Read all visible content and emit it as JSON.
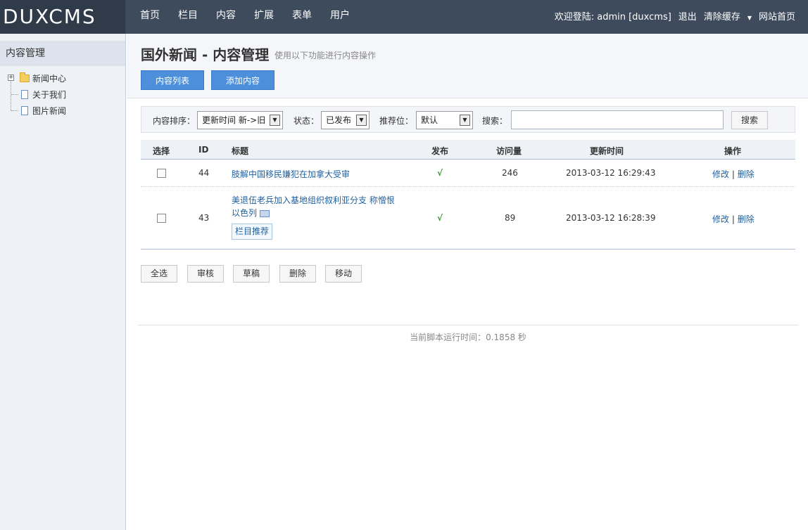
{
  "app": {
    "logo": "DUXCMS"
  },
  "nav": {
    "items": [
      "首页",
      "栏目",
      "内容",
      "扩展",
      "表单",
      "用户"
    ]
  },
  "userbar": {
    "welcome": "欢迎登陆: admin [duxcms]",
    "logout": "退出",
    "clear_cache": "清除缓存",
    "site_home": "网站首页"
  },
  "sidebar": {
    "title": "内容管理",
    "tree": [
      {
        "label": "新闻中心",
        "icon": "folder-icon"
      },
      {
        "label": "关于我们",
        "icon": "document-icon"
      },
      {
        "label": "图片新闻",
        "icon": "document-icon"
      }
    ]
  },
  "header": {
    "title": "国外新闻 - 内容管理",
    "subtitle": "使用以下功能进行内容操作",
    "tabs": [
      "内容列表",
      "添加内容"
    ]
  },
  "filter": {
    "sort_label": "内容排序：",
    "sort_value": "更新时间 新->旧",
    "status_label": "状态：",
    "status_value": "已发布",
    "position_label": "推荐位：",
    "position_value": "默认",
    "search_label": "搜索：",
    "search_placeholder": "",
    "search_button": "搜索"
  },
  "table": {
    "headers": [
      "选择",
      "ID",
      "标题",
      "发布",
      "访问量",
      "更新时间",
      "操作"
    ],
    "rows": [
      {
        "id": "44",
        "title": "肢解中国移民嫌犯在加拿大受审",
        "title2": "",
        "published": "√",
        "views": "246",
        "updated": "2013-03-12 16:29:43",
        "edit": "修改",
        "sep": "|",
        "delete": "删除",
        "tag": ""
      },
      {
        "id": "43",
        "title": "美退伍老兵加入基地组织叙利亚分支 称憎恨",
        "title2": "以色列",
        "published": "√",
        "views": "89",
        "updated": "2013-03-12 16:28:39",
        "edit": "修改",
        "sep": "|",
        "delete": "删除",
        "tag": "栏目推荐"
      }
    ]
  },
  "actions": [
    "全选",
    "审核",
    "草稿",
    "删除",
    "移动"
  ],
  "footer": {
    "runtime": "当前脚本运行时间：0.1858 秒"
  }
}
